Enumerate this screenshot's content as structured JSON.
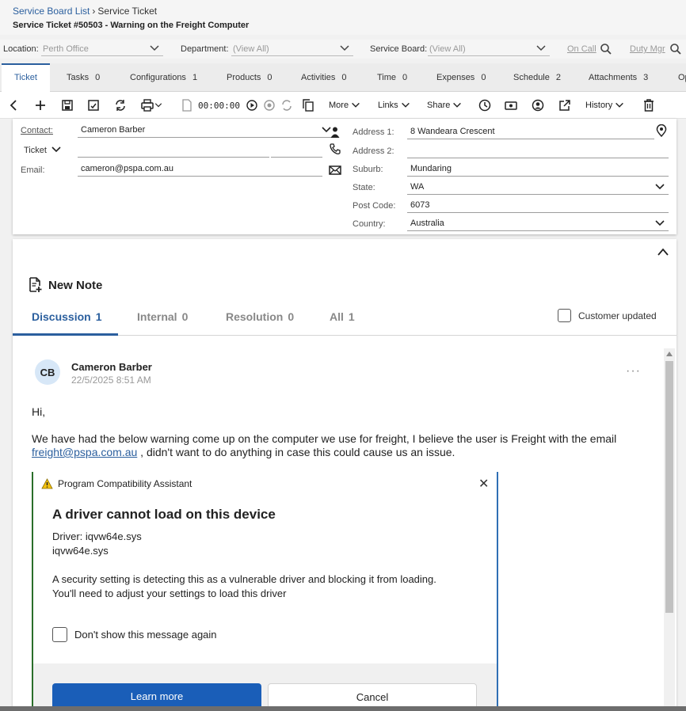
{
  "breadcrumb": {
    "list": "Service Board List",
    "current": "Service Ticket"
  },
  "page_title": "Service Ticket #50503 - Warning on the Freight Computer",
  "filters": {
    "location_label": "Location:",
    "location_value": "Perth Office",
    "department_label": "Department:",
    "department_value": "(View All)",
    "board_label": "Service Board:",
    "board_value": "(View All)",
    "on_call": "On Call",
    "duty_mgr": "Duty Mgr"
  },
  "tabs": [
    {
      "label": "Ticket",
      "count": ""
    },
    {
      "label": "Tasks",
      "count": "0"
    },
    {
      "label": "Configurations",
      "count": "1"
    },
    {
      "label": "Products",
      "count": "0"
    },
    {
      "label": "Activities",
      "count": "0"
    },
    {
      "label": "Time",
      "count": "0"
    },
    {
      "label": "Expenses",
      "count": "0"
    },
    {
      "label": "Schedule",
      "count": "2"
    },
    {
      "label": "Attachments",
      "count": "3"
    },
    {
      "label": "Op",
      "count": ""
    }
  ],
  "toolbar": {
    "timer": "00:00:00",
    "more": "More",
    "links": "Links",
    "share": "Share",
    "history": "History"
  },
  "contact": {
    "contact_label": "Contact:",
    "contact_value": "Cameron Barber",
    "ticket_label": "Ticket",
    "email_label": "Email:",
    "email_value": "cameron@pspa.com.au",
    "address1_label": "Address 1:",
    "address1_value": "8 Wandeara Crescent",
    "address2_label": "Address 2:",
    "address2_value": "",
    "suburb_label": "Suburb:",
    "suburb_value": "Mundaring",
    "state_label": "State:",
    "state_value": "WA",
    "postcode_label": "Post Code:",
    "postcode_value": "6073",
    "country_label": "Country:",
    "country_value": "Australia"
  },
  "notes": {
    "new_note": "New Note",
    "tabs": [
      {
        "label": "Discussion",
        "count": "1"
      },
      {
        "label": "Internal",
        "count": "0"
      },
      {
        "label": "Resolution",
        "count": "0"
      },
      {
        "label": "All",
        "count": "1"
      }
    ],
    "customer_updated": "Customer updated"
  },
  "note": {
    "initials": "CB",
    "author": "Cameron Barber",
    "date": "22/5/2025 8:51 AM",
    "greeting": "Hi,",
    "body_line1": "We have had the below warning come up on the computer we use for freight, I believe the user is Freight with the email",
    "email_link": "freight@pspa.com.au",
    "body_line2_rest": " , didn't want to do anything in case this could cause us an issue."
  },
  "dialog": {
    "app_title": "Program Compatibility Assistant",
    "heading": "A driver cannot load on this device",
    "driver_line": "Driver: iqvw64e.sys",
    "driver_file": "iqvw64e.sys",
    "message_line1": "A security setting is detecting this as a vulnerable driver and blocking it from loading.",
    "message_line2": "You'll need to adjust your settings to load this driver",
    "dont_show": "Don't show this message again",
    "learn_more": "Learn more",
    "cancel": "Cancel"
  },
  "colors": {
    "accent": "#2b5f9e",
    "button_primary": "#1a5eb8"
  }
}
